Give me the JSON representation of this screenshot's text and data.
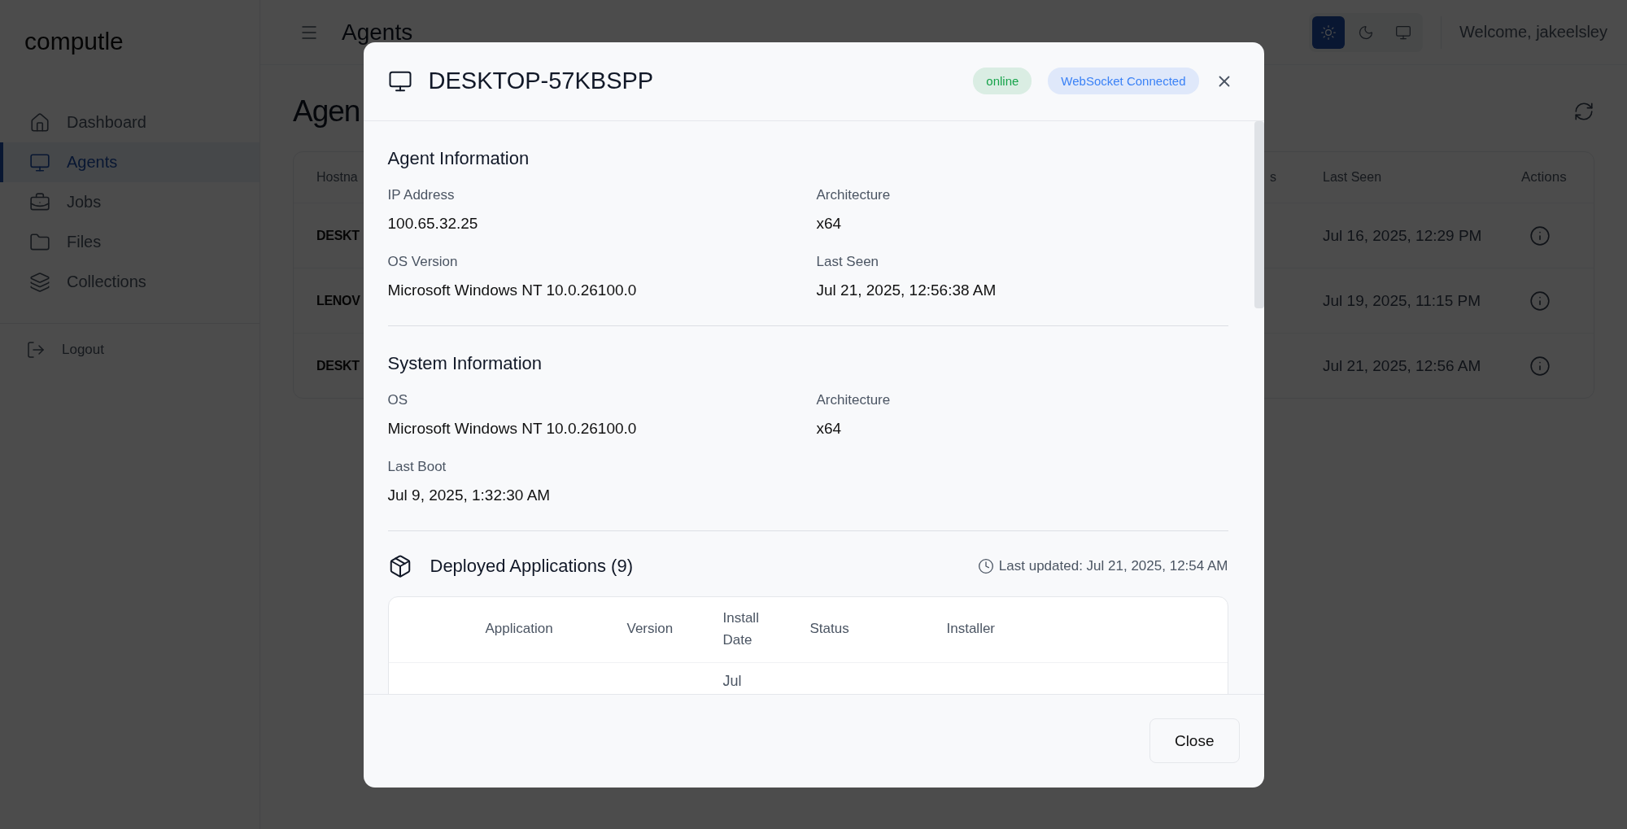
{
  "sidebar": {
    "logo": "computle",
    "items": [
      {
        "label": "Dashboard",
        "selected": false
      },
      {
        "label": "Agents",
        "selected": true
      },
      {
        "label": "Jobs",
        "selected": false
      },
      {
        "label": "Files",
        "selected": false
      },
      {
        "label": "Collections",
        "selected": false
      }
    ],
    "logout": "Logout"
  },
  "header": {
    "title": "Agents",
    "theme_options": [
      {
        "selected": true
      },
      {
        "selected": false
      },
      {
        "selected": false
      }
    ],
    "welcome": "Welcome, jakeelsley"
  },
  "page": {
    "title": "Agen",
    "table": {
      "columns": [
        "Hostna",
        "s",
        "Last Seen",
        "Actions"
      ],
      "rows": [
        {
          "hostname": "DESKT",
          "last_seen": "Jul 16, 2025, 12:29 PM"
        },
        {
          "hostname": "LENOV",
          "last_seen": "Jul 19, 2025, 11:15 PM"
        },
        {
          "hostname": "DESKT",
          "last_seen": "Jul 21, 2025, 12:56 AM"
        }
      ]
    }
  },
  "modal": {
    "title": "DESKTOP-57KBSPP",
    "badges": [
      {
        "label": "online",
        "color": "#16a34a"
      },
      {
        "label": "WebSocket Connected",
        "color": "#3b82f6"
      }
    ],
    "sections": [
      {
        "title": "Agent Information",
        "fields": [
          {
            "label": "IP Address",
            "value": "100.65.32.25"
          },
          {
            "label": "Architecture",
            "value": "x64"
          },
          {
            "label": "OS Version",
            "value": "Microsoft Windows NT 10.0.26100.0"
          },
          {
            "label": "Last Seen",
            "value": "Jul 21, 2025, 12:56:38 AM"
          }
        ]
      },
      {
        "title": "System Information",
        "fields": [
          {
            "label": "OS",
            "value": "Microsoft Windows NT 10.0.26100.0"
          },
          {
            "label": "Architecture",
            "value": "x64"
          },
          {
            "label": "Last Boot",
            "value": "Jul 9, 2025, 1:32:30 AM"
          }
        ]
      }
    ],
    "applications": {
      "title": "Deployed Applications (9)",
      "updated": "Last updated: Jul 21, 2025, 12:54 AM",
      "columns": [
        "Application",
        "Version",
        "Install Date",
        "Status",
        "Installer"
      ],
      "rows": [
        [
          "",
          "",
          "Jul",
          "",
          ""
        ]
      ]
    },
    "close": "Close"
  }
}
